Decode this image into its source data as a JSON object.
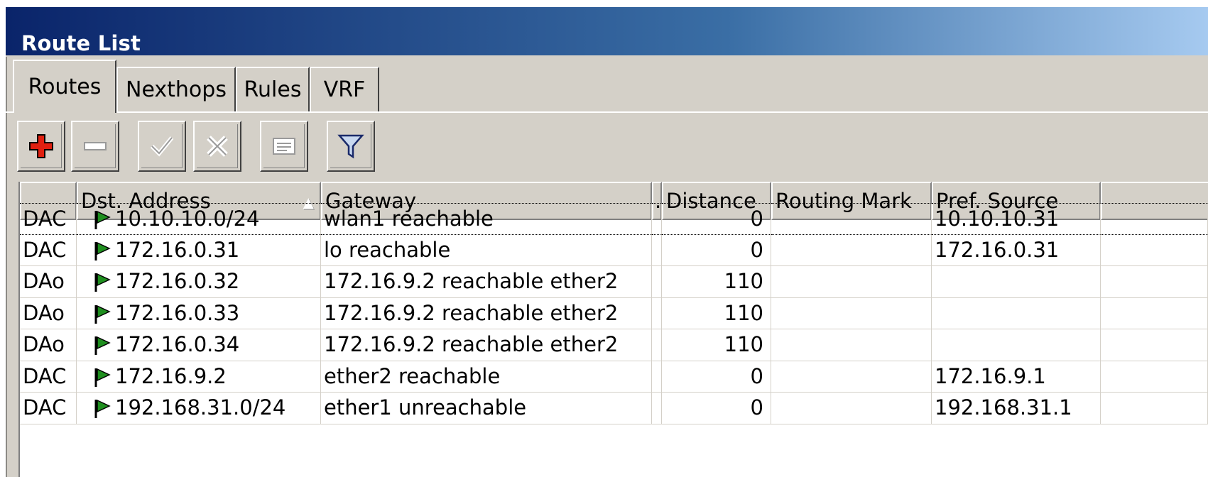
{
  "window": {
    "title": "Route List"
  },
  "tabs": [
    {
      "label": "Routes",
      "active": true
    },
    {
      "label": "Nexthops",
      "active": false
    },
    {
      "label": "Rules",
      "active": false
    },
    {
      "label": "VRF",
      "active": false
    }
  ],
  "toolbar": {
    "buttons": [
      {
        "icon": "plus-icon",
        "enabled": true
      },
      {
        "icon": "minus-icon",
        "enabled": false
      },
      {
        "icon": "check-icon",
        "enabled": false
      },
      {
        "icon": "cross-icon",
        "enabled": false
      },
      {
        "icon": "comment-icon",
        "enabled": false
      },
      {
        "icon": "filter-icon",
        "enabled": true
      }
    ]
  },
  "table": {
    "columns": [
      "",
      "Dst. Address",
      "Gateway",
      ".",
      "Distance",
      "Routing Mark",
      "Pref. Source"
    ],
    "sort_indicator": "▲",
    "rows": [
      {
        "flags": "DAC",
        "dst": "10.10.10.0/24",
        "gateway": "wlan1 reachable",
        "distance": "0",
        "mark": "",
        "pref": "10.10.10.31"
      },
      {
        "flags": "DAC",
        "dst": "172.16.0.31",
        "gateway": "lo reachable",
        "distance": "0",
        "mark": "",
        "pref": "172.16.0.31"
      },
      {
        "flags": "DAo",
        "dst": "172.16.0.32",
        "gateway": "172.16.9.2 reachable ether2",
        "distance": "110",
        "mark": "",
        "pref": ""
      },
      {
        "flags": "DAo",
        "dst": "172.16.0.33",
        "gateway": "172.16.9.2 reachable ether2",
        "distance": "110",
        "mark": "",
        "pref": ""
      },
      {
        "flags": "DAo",
        "dst": "172.16.0.34",
        "gateway": "172.16.9.2 reachable ether2",
        "distance": "110",
        "mark": "",
        "pref": ""
      },
      {
        "flags": "DAC",
        "dst": "172.16.9.2",
        "gateway": "ether2 reachable",
        "distance": "0",
        "mark": "",
        "pref": "172.16.9.1"
      },
      {
        "flags": "DAC",
        "dst": "192.168.31.0/24",
        "gateway": "ether1 unreachable",
        "distance": "0",
        "mark": "",
        "pref": "192.168.31.1"
      }
    ]
  },
  "colors": {
    "title_bar_start": "#0a246a",
    "title_bar_end": "#a6caf0",
    "flag_green": "#1f8f1f",
    "add_red": "#e02010"
  }
}
